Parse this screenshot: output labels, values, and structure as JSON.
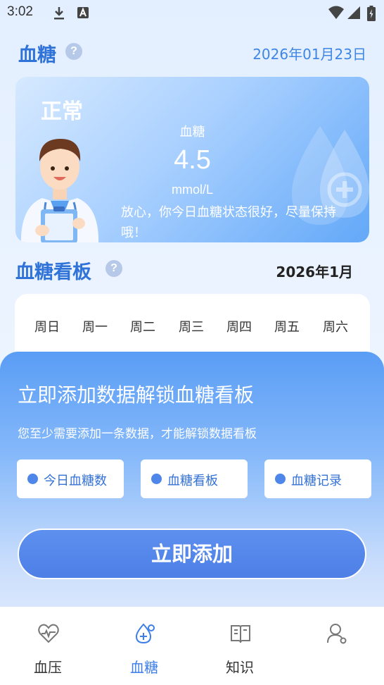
{
  "status_bar": {
    "time": "3:02"
  },
  "header": {
    "title": "血糖",
    "date": "2026年01月23日",
    "help": "?"
  },
  "status_card": {
    "status": "正常",
    "metric_name": "血糖",
    "value": "4.5",
    "unit": "mmol/L",
    "message": "放心，你今日血糖状态很好，尽量保持哦！"
  },
  "board": {
    "title": "血糖看板",
    "help": "?",
    "month": "2026年1月",
    "weekdays": [
      "周日",
      "周一",
      "周二",
      "周三",
      "周四",
      "周五",
      "周六"
    ]
  },
  "unlock": {
    "title": "立即添加数据解锁血糖看板",
    "subtitle": "您至少需要添加一条数据，才能解锁数据看板",
    "features": [
      "今日血糖数",
      "血糖看板",
      "血糖记录"
    ],
    "button": "立即添加"
  },
  "nav": {
    "items": [
      {
        "label": "血压",
        "icon": "heart-pulse-icon"
      },
      {
        "label": "血糖",
        "icon": "blood-drop-plus-icon",
        "active": true
      },
      {
        "label": "知识",
        "icon": "book-icon"
      },
      {
        "label": "",
        "icon": "user-icon"
      }
    ]
  },
  "colors": {
    "accent": "#2f72d8",
    "button": "#4d7fe6",
    "active_nav": "#3e7ee8"
  }
}
